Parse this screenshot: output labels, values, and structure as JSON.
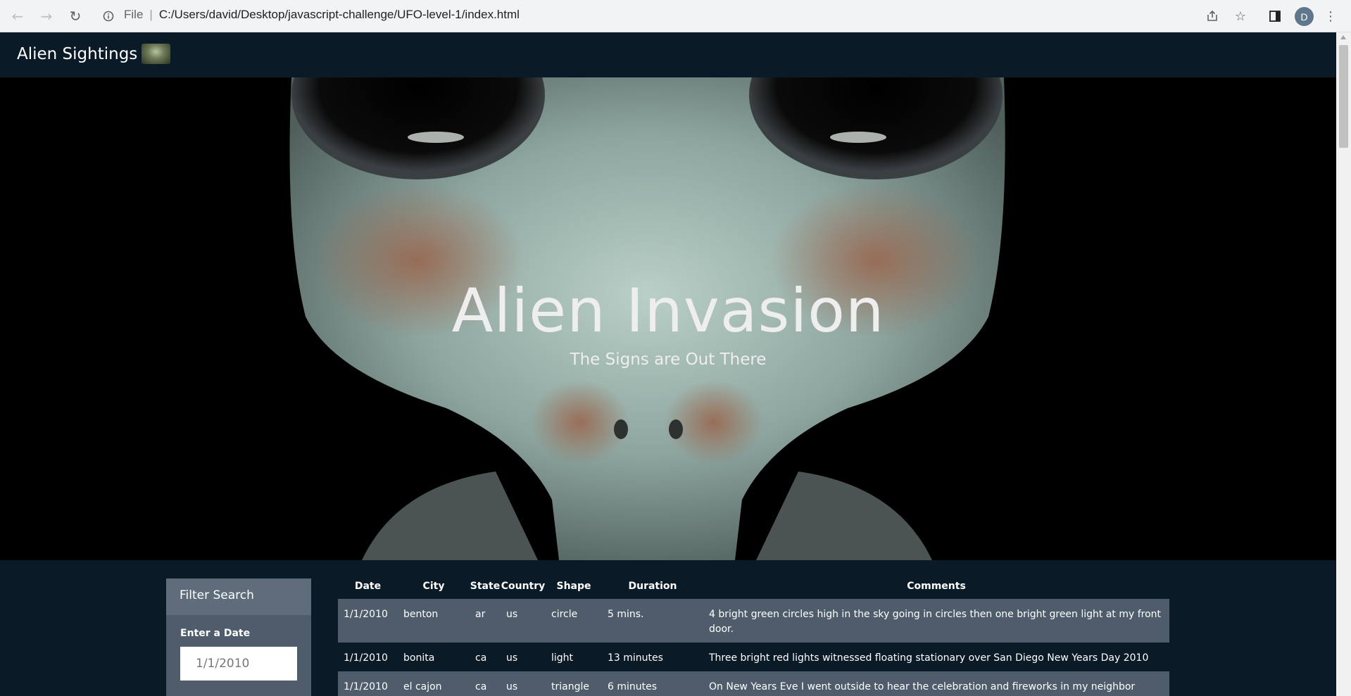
{
  "browser": {
    "file_label": "File",
    "url": "C:/Users/david/Desktop/javascript-challenge/UFO-level-1/index.html",
    "profile_initial": "D",
    "icons": [
      "back-arrow-icon",
      "forward-arrow-icon",
      "reload-icon",
      "info-icon",
      "share-icon",
      "star-icon",
      "side-panel-icon",
      "kebab-menu-icon"
    ]
  },
  "navbar": {
    "brand": "Alien Sightings"
  },
  "hero": {
    "title": "Alien Invasion",
    "subtitle": "The Signs are Out There"
  },
  "filter": {
    "heading": "Filter Search",
    "date_label": "Enter a Date",
    "date_placeholder": "1/1/2010"
  },
  "table": {
    "columns": [
      "Date",
      "City",
      "State",
      "Country",
      "Shape",
      "Duration",
      "Comments"
    ],
    "rows": [
      [
        "1/1/2010",
        "benton",
        "ar",
        "us",
        "circle",
        "5 mins.",
        "4 bright green circles high in the sky going in circles then one bright green light at my front door."
      ],
      [
        "1/1/2010",
        "bonita",
        "ca",
        "us",
        "light",
        "13 minutes",
        "Three bright red lights witnessed floating stationary over San Diego New Years Day 2010"
      ],
      [
        "1/1/2010",
        "el cajon",
        "ca",
        "us",
        "triangle",
        "6 minutes",
        "On New Years Eve I went outside to hear the celebration and fireworks in my neighbor"
      ]
    ]
  },
  "colors": {
    "page_bg": "#0b1a27",
    "panel_bg": "#4e5c6b",
    "panel_head_bg": "#5e6c7b",
    "text": "#ffffff"
  }
}
